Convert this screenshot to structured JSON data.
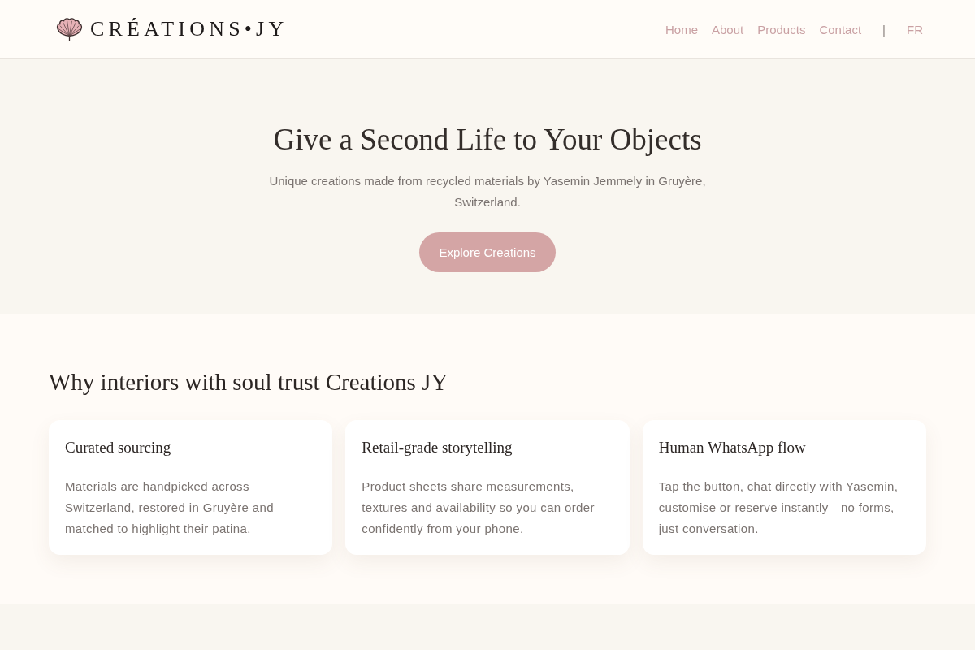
{
  "header": {
    "logo": {
      "text": "CRÉATIONS•JY"
    },
    "nav": [
      {
        "label": "Home"
      },
      {
        "label": "About"
      },
      {
        "label": "Products"
      },
      {
        "label": "Contact"
      }
    ],
    "separator": "|",
    "language": "FR"
  },
  "hero": {
    "title": "Give a Second Life to Your Objects",
    "subtitle": "Unique creations made from recycled materials by Yasemin Jemmely in Gruyère, Switzerland.",
    "button": "Explore Creations"
  },
  "features": {
    "heading": "Why interiors with soul trust Creations JY",
    "cards": [
      {
        "title": "Curated sourcing",
        "body": "Materials are handpicked across Switzerland, restored in Gruyère and matched to highlight their patina."
      },
      {
        "title": "Retail-grade storytelling",
        "body": "Product sheets share measurements, textures and availability so you can order confidently from your phone."
      },
      {
        "title": "Human WhatsApp flow",
        "body": "Tap the button, chat directly with Yasemin, customise or reserve instantly—no forms, just conversation."
      }
    ]
  }
}
